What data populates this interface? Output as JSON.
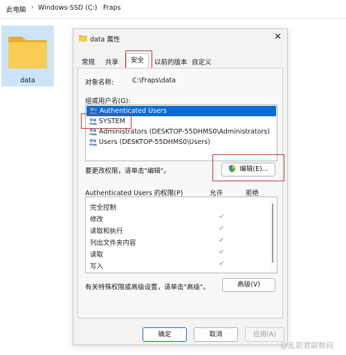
{
  "explorer": {
    "breadcrumb": [
      "此电脑",
      "Windows-SSD (C:)",
      "Fraps"
    ],
    "folder_name": "data"
  },
  "dialog": {
    "title": "data 属性",
    "tabs": [
      "常规",
      "共享",
      "安全",
      "以前的版本",
      "自定义"
    ],
    "active_tab": "安全",
    "object_label": "对象名称:",
    "object_value": "C:\\Fraps\\data",
    "group_label": "组或用户名(G):",
    "users": [
      "Authenticated Users",
      "SYSTEM",
      "Administrators (DESKTOP-55DHMS0\\Administrators)",
      "Users (DESKTOP-55DHMS0\\Users)"
    ],
    "selected_user": 0,
    "change_hint": "要更改权限，请单击\"编辑\"。",
    "edit_button": "编辑(E)...",
    "perm_label": "Authenticated Users 的权限(P)",
    "allow_header": "允许",
    "deny_header": "拒绝",
    "permissions": [
      "完全控制",
      "修改",
      "读取和执行",
      "列出文件夹内容",
      "读取",
      "写入"
    ],
    "allowed": [
      false,
      true,
      true,
      true,
      true,
      true
    ],
    "advanced_hint": "有关特殊权限或高级设置，请单击\"高级\"。",
    "advanced_button": "高级(V)",
    "ok_button": "确定",
    "cancel_button": "取消",
    "apply_button": "应用(A)"
  },
  "watermark": "@乱箭君聊数码",
  "colors": {
    "selection": "#0a6cd6",
    "highlight_box": "#c0352c",
    "folder": "#f5c542"
  }
}
